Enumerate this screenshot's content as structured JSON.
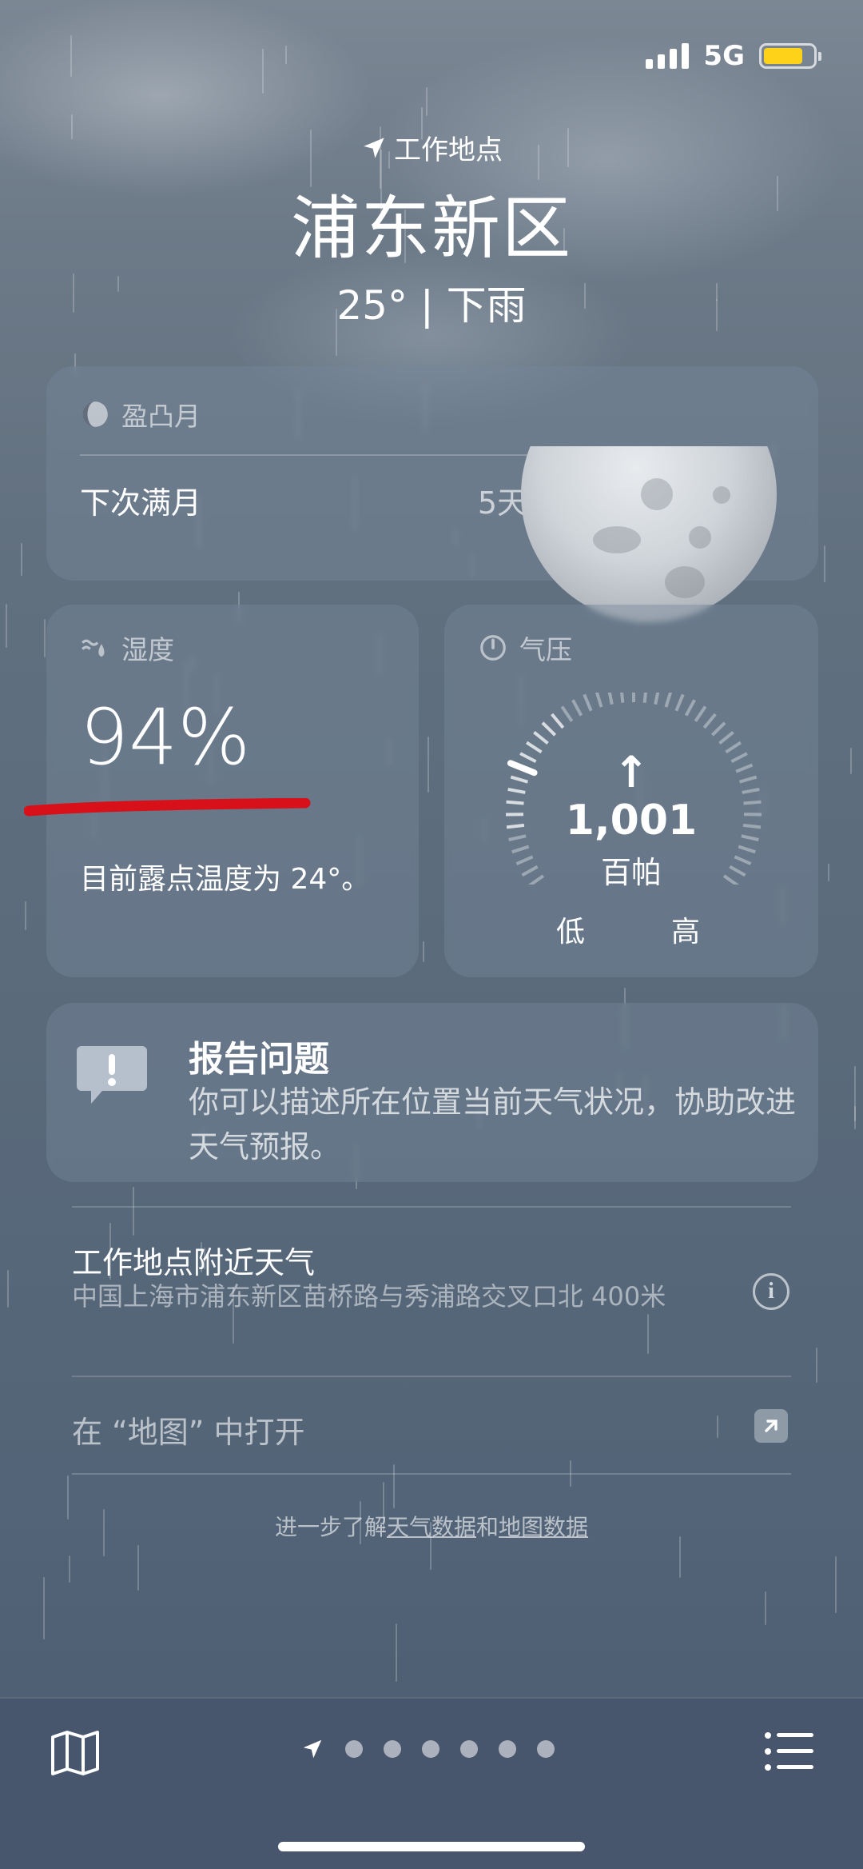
{
  "status_bar": {
    "network": "5G"
  },
  "header": {
    "location_label": "工作地点",
    "city": "浦东新区",
    "condition": "25° | 下雨"
  },
  "moon": {
    "phase": "盈凸月",
    "next_full_label": "下次满月",
    "next_full_value": "5天"
  },
  "humidity": {
    "title": "湿度",
    "value": "94%",
    "description": "目前露点温度为 24°。"
  },
  "pressure": {
    "title": "气压",
    "arrow": "↑",
    "value": "1,001",
    "unit": "百帕",
    "low": "低",
    "high": "高"
  },
  "report": {
    "title": "报告问题",
    "description": "你可以描述所在位置当前天气状况，协助改进天气预报。"
  },
  "nearby": {
    "title": "工作地点附近天气",
    "address": "中国上海市浦东新区苗桥路与秀浦路交叉口北 400米"
  },
  "open_in_maps": "在 “地图” 中打开",
  "footer": {
    "prefix": "进一步了解",
    "link1": "天气数据",
    "middle": "和",
    "link2": "地图数据"
  },
  "colors": {
    "battery": "#ffd21a",
    "annotation": "#d8101a"
  },
  "icons": [
    "location-arrow-icon",
    "moon-phase-icon",
    "humidity-icon",
    "gauge-icon",
    "report-bubble-icon",
    "info-icon",
    "open-external-icon",
    "map-icon",
    "list-icon"
  ]
}
